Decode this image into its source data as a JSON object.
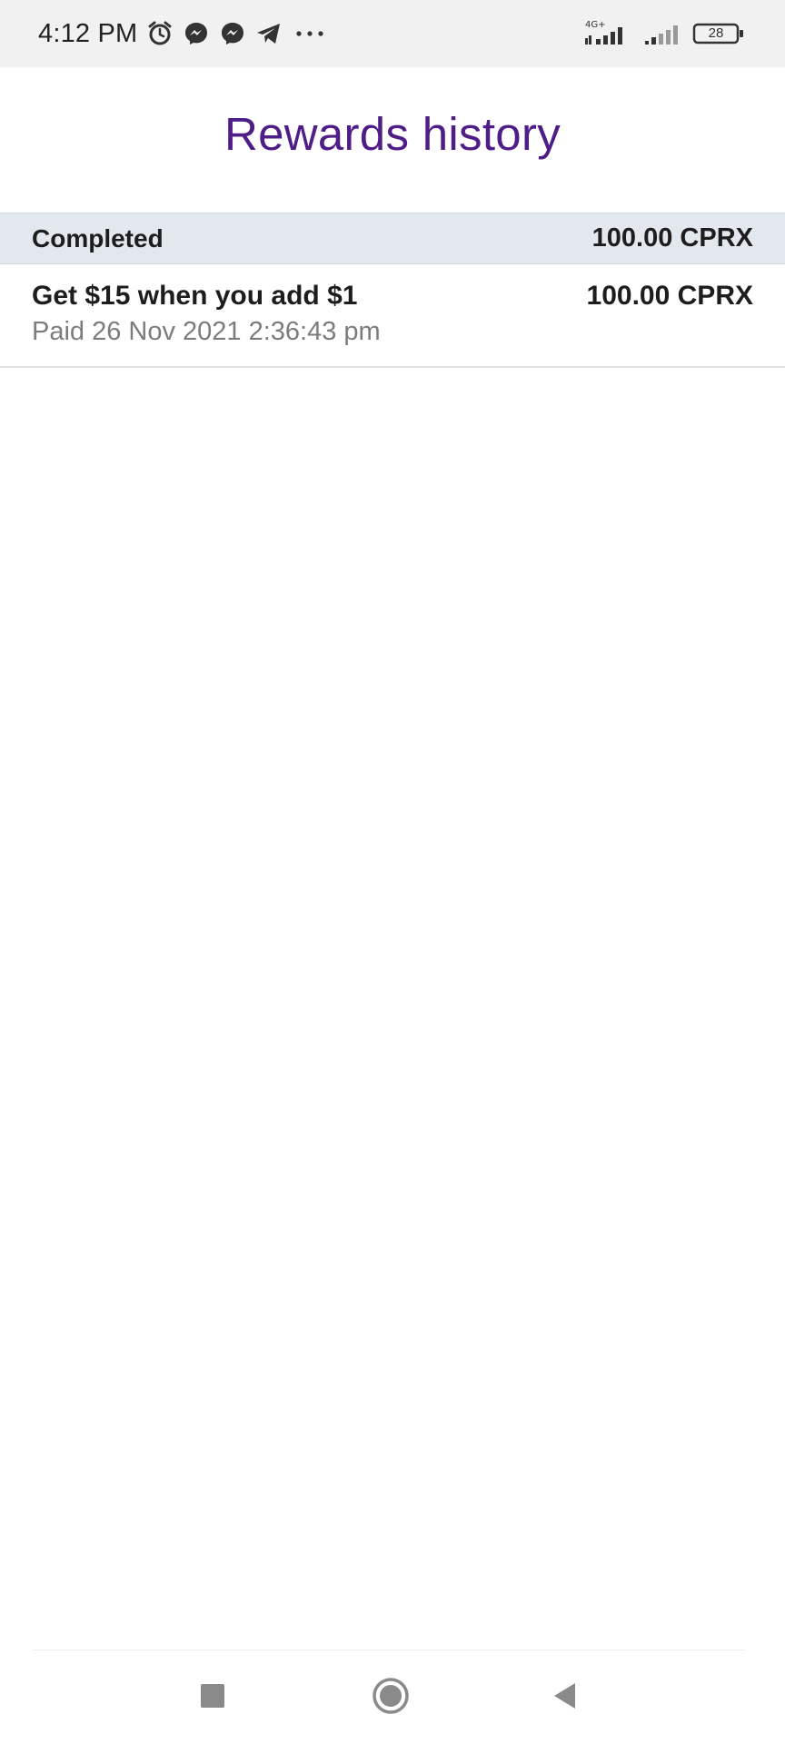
{
  "status_bar": {
    "time": "4:12 PM",
    "icons_left": [
      "alarm-icon",
      "messenger-icon",
      "messenger-icon",
      "telegram-icon",
      "more-icon"
    ],
    "network_label": "4G+",
    "battery_level": "28"
  },
  "page": {
    "title": "Rewards history"
  },
  "section": {
    "title": "Completed",
    "total": "100.00 CPRX"
  },
  "rewards": [
    {
      "title": "Get $15 when you add $1",
      "subtitle": "Paid 26 Nov 2021 2:36:43 pm",
      "amount": "100.00 CPRX"
    }
  ],
  "colors": {
    "title": "#4f1d87",
    "section_bg": "#e2e8ee",
    "subtitle": "#7c7c7c"
  },
  "nav": {
    "items": [
      "recents-icon",
      "home-icon",
      "back-icon"
    ]
  }
}
